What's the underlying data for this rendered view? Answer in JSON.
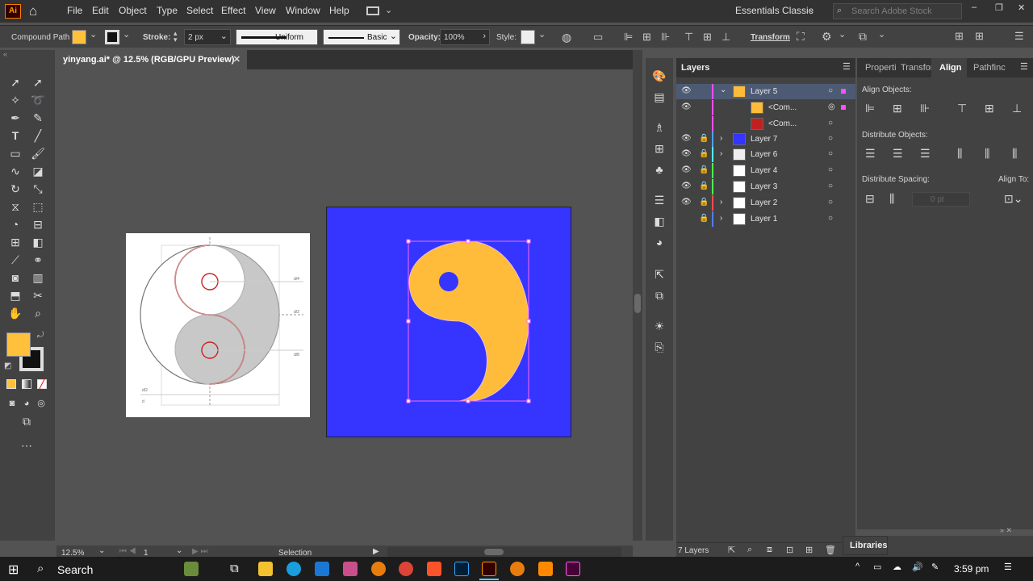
{
  "menubar": {
    "items": [
      "File",
      "Edit",
      "Object",
      "Type",
      "Select",
      "Effect",
      "View",
      "Window",
      "Help"
    ],
    "workspace": "Essentials Classic",
    "search_placeholder": "Search Adobe Stock"
  },
  "control": {
    "selection_type": "Compound Path",
    "stroke_label": "Stroke:",
    "stroke_weight": "2 px",
    "profile": "Uniform",
    "brush": "Basic",
    "opacity_label": "Opacity:",
    "opacity": "100%",
    "style_label": "Style:",
    "transform_label": "Transform",
    "fill_color": "#ffc13b"
  },
  "document": {
    "tab_title": "yinyang.ai* @ 12.5% (RGB/GPU Preview)"
  },
  "status": {
    "zoom": "12.5%",
    "artboard": "1",
    "tool": "Selection"
  },
  "layers": {
    "title": "Layers",
    "rows": [
      {
        "name": "Layer 5",
        "color": "#ff4fff"
      },
      {
        "name": "<Com...",
        "color": "#ff4fff"
      },
      {
        "name": "<Com...",
        "color": "#ff4fff"
      },
      {
        "name": "Layer 7",
        "color": "#4fa0ff"
      },
      {
        "name": "Layer 6",
        "color": "#4fffff"
      },
      {
        "name": "Layer 4",
        "color": "#4fff4f"
      },
      {
        "name": "Layer 3",
        "color": "#4fff4f"
      },
      {
        "name": "Layer 2",
        "color": "#ff4f4f"
      },
      {
        "name": "Layer 1",
        "color": "#4f7fff"
      }
    ],
    "count": "7 Layers"
  },
  "align": {
    "tabs": [
      "Properti",
      "Transfor",
      "Align",
      "Pathfinc"
    ],
    "align_objects": "Align Objects:",
    "distribute_objects": "Distribute Objects:",
    "distribute_spacing": "Distribute Spacing:",
    "align_to": "Align To:",
    "spacing_value": "0 pt"
  },
  "libraries": {
    "title": "Libraries"
  },
  "taskbar": {
    "search": "Search",
    "time": "3:59 pm"
  },
  "colors": {
    "artboard_bg": "#3535ff",
    "yin": "#ffbc3a"
  },
  "guide_labels": [
    "d/4",
    "d/2",
    "d/8",
    "d/2",
    "d"
  ]
}
